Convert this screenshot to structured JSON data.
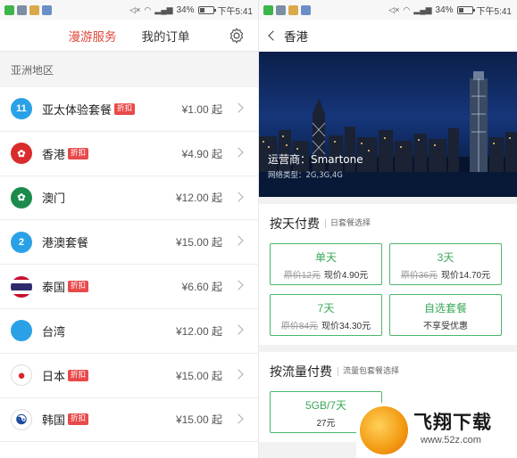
{
  "status": {
    "battery": "34%",
    "time": "下午5:41"
  },
  "left": {
    "tabs": [
      {
        "label": "漫游服务"
      },
      {
        "label": "我的订单"
      }
    ],
    "section_title": "亚洲地区",
    "discount_badge": "折扣",
    "items": [
      {
        "name": "亚太体验套餐",
        "price": "¥1.00 起",
        "discount": true,
        "flag": "asia-pacific-icon",
        "color": "#2aa1e6",
        "icon_text": "11"
      },
      {
        "name": "香港",
        "price": "¥4.90 起",
        "discount": true,
        "flag": "hong-kong-flag-icon",
        "color": "#d92c2c",
        "icon_text": "✿"
      },
      {
        "name": "澳门",
        "price": "¥12.00 起",
        "discount": false,
        "flag": "macau-flag-icon",
        "color": "#1b8b4d",
        "icon_text": "✿"
      },
      {
        "name": "港澳套餐",
        "price": "¥15.00 起",
        "discount": false,
        "flag": "hk-macau-bundle-icon",
        "color": "#2aa1e6",
        "icon_text": "2"
      },
      {
        "name": "泰国",
        "price": "¥6.60 起",
        "discount": true,
        "flag": "thailand-flag-icon",
        "color": "#2d2a6e",
        "icon_text": ""
      },
      {
        "name": "台湾",
        "price": "¥12.00 起",
        "discount": false,
        "flag": "taiwan-icon",
        "color": "#2aa1e6",
        "icon_text": ""
      },
      {
        "name": "日本",
        "price": "¥15.00 起",
        "discount": true,
        "flag": "japan-flag-icon",
        "color": "#ffffff",
        "icon_text": "●"
      },
      {
        "name": "韩国",
        "price": "¥15.00 起",
        "discount": true,
        "flag": "korea-flag-icon",
        "color": "#ffffff",
        "icon_text": "☯"
      }
    ]
  },
  "right": {
    "title": "香港",
    "operator": "运营商：Smartone",
    "network": "网络类型：2G,3G,4G",
    "daily": {
      "title": "按天付费",
      "subtitle": "日套餐选择",
      "options": [
        {
          "title": "单天",
          "orig": "原价12元",
          "now": "现价4.90元"
        },
        {
          "title": "3天",
          "orig": "原价36元",
          "now": "现价14.70元"
        },
        {
          "title": "7天",
          "orig": "原价84元",
          "now": "现价34.30元"
        },
        {
          "title": "自选套餐",
          "orig": "",
          "now": "不享受优惠"
        }
      ]
    },
    "traffic": {
      "title": "按流量付费",
      "subtitle": "流量包套餐选择",
      "options": [
        {
          "title": "5GB/7天",
          "now": "27元"
        }
      ]
    },
    "watermark": {
      "brand": "飞翔下载",
      "url": "www.52z.com"
    }
  }
}
